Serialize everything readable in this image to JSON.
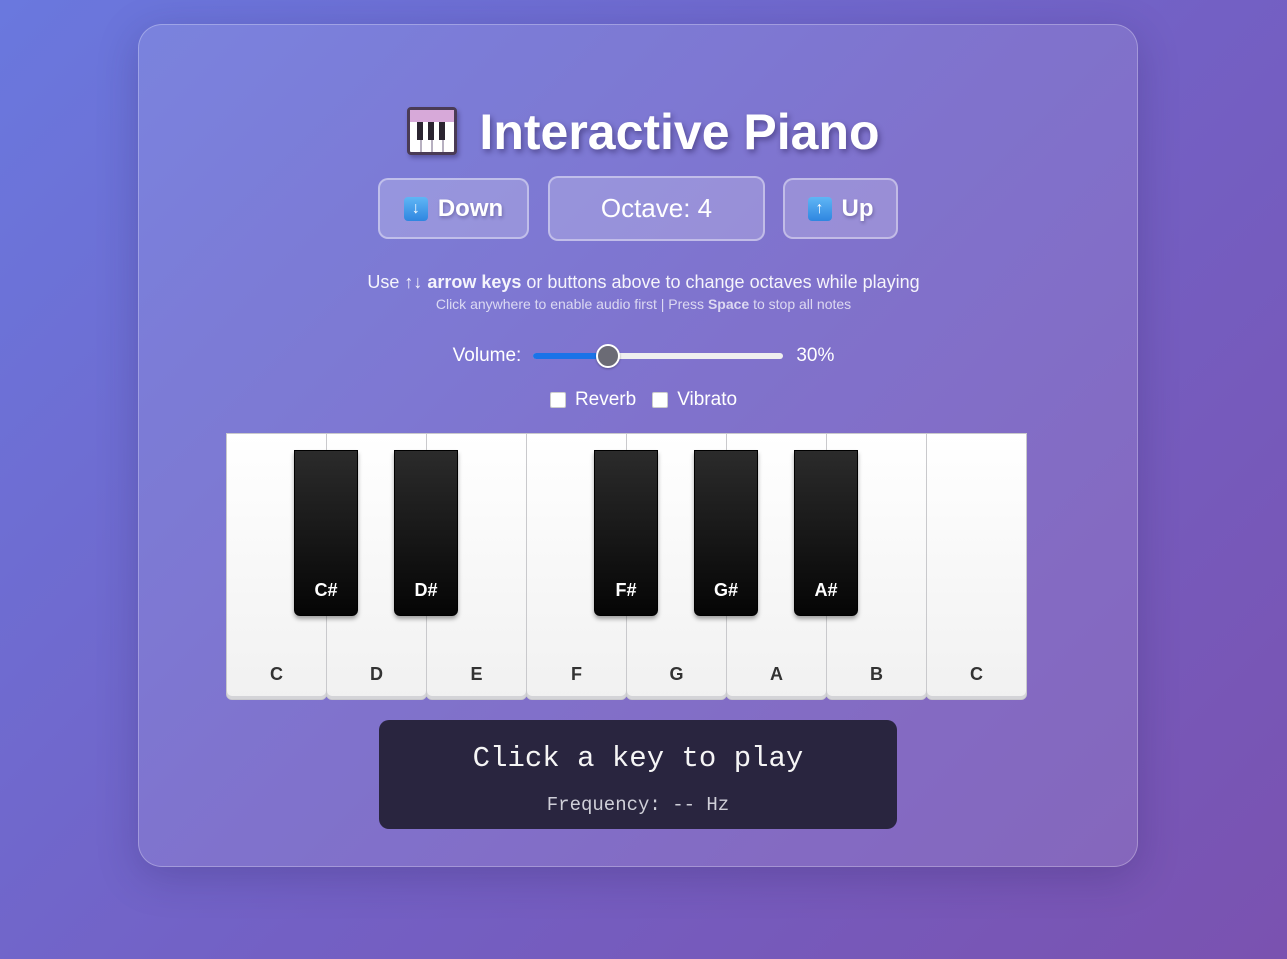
{
  "header": {
    "title": "Interactive Piano",
    "icon": "piano-keyboard-icon"
  },
  "octave_controls": {
    "down_label": "Down",
    "down_icon": "arrow-down-icon",
    "octave_label": "Octave: 4",
    "up_label": "Up",
    "up_icon": "arrow-up-icon"
  },
  "instructions": {
    "line1_prefix": "Use ↑↓ ",
    "line1_bold": "arrow keys",
    "line1_suffix": " or buttons above to change octaves while playing",
    "line2_prefix": "Click anywhere to enable audio first | Press ",
    "line2_bold": "Space",
    "line2_suffix": " to stop all notes"
  },
  "volume": {
    "label": "Volume:",
    "value": 0.3,
    "display": "30%",
    "accent": "#1a73e8"
  },
  "effects": [
    {
      "label": "Reverb",
      "checked": false
    },
    {
      "label": "Vibrato",
      "checked": false
    }
  ],
  "piano": {
    "white_keys": [
      "C",
      "D",
      "E",
      "F",
      "G",
      "A",
      "B",
      "C"
    ],
    "black_keys": [
      "C#",
      "D#",
      "F#",
      "G#",
      "A#"
    ]
  },
  "display": {
    "note_text": "Click a key to play",
    "frequency_text": "Frequency: -- Hz"
  }
}
